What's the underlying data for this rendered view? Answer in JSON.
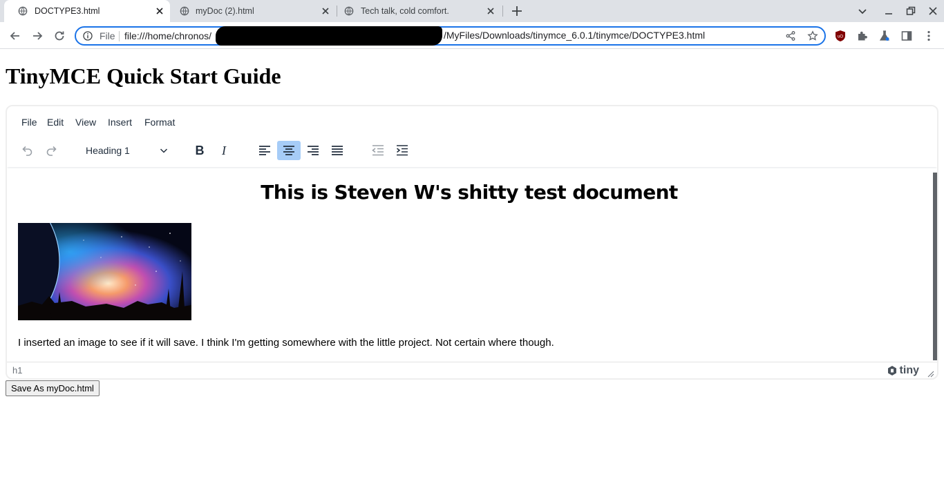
{
  "browser": {
    "tabs": [
      {
        "title": "DOCTYPE3.html",
        "active": true
      },
      {
        "title": "myDoc (2).html",
        "active": false
      },
      {
        "title": "Tech talk, cold comfort.",
        "active": false
      }
    ],
    "address": {
      "chip": "File",
      "url_start": "file:///home/chronos/",
      "url_end": "/MyFiles/Downloads/tinymce_6.0.1/tinymce/DOCTYPE3.html"
    }
  },
  "page": {
    "title": "TinyMCE Quick Start Guide",
    "save_button": "Save As myDoc.html"
  },
  "editor": {
    "menus": [
      "File",
      "Edit",
      "View",
      "Insert",
      "Format"
    ],
    "block_format": "Heading 1",
    "active_alignment": "center",
    "content": {
      "heading": "This is Steven W's shitty test document",
      "paragraph": "I inserted an image to see if it will save.  I think I'm getting somewhere with the little project.  Not certain where though."
    },
    "status_path": "h1",
    "brand": "tiny"
  },
  "colors": {
    "accent": "#1a73e8",
    "active_button": "#a6ccf7",
    "tab_strip": "#dee1e6"
  }
}
